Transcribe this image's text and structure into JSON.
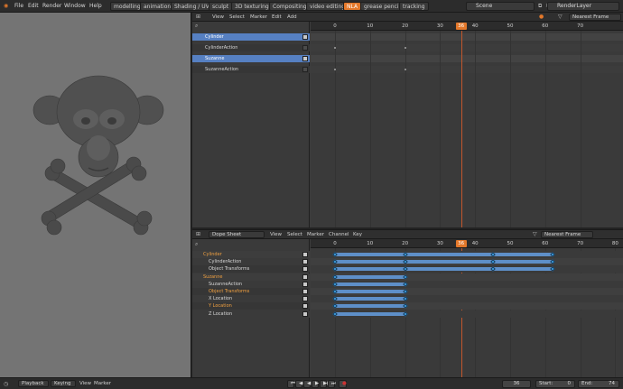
{
  "topbar": {
    "menus": [
      "File",
      "Edit",
      "Render",
      "Window",
      "Help"
    ],
    "workspaces": [
      "modelling",
      "animation",
      "Shading / UV",
      "sculpt",
      "3D texturing",
      "Compositing",
      "video editing",
      "NLA",
      "grease pencil",
      "tracking"
    ],
    "active_workspace": "NLA",
    "scene": "Scene",
    "render_layer": "RenderLayer"
  },
  "nla": {
    "header": {
      "menus": [
        "View",
        "Select",
        "Marker",
        "Edit",
        "Add"
      ],
      "snap": "Nearest Frame"
    },
    "channels": [
      "Cylinder",
      "CylinderAction",
      "Suzanne",
      "SuzanneAction"
    ],
    "ruler": [
      "0",
      "10",
      "20",
      "30",
      "36",
      "40",
      "50",
      "60",
      "70"
    ]
  },
  "dopesheet": {
    "header": {
      "mode": "Dope Sheet",
      "menus": [
        "View",
        "Select",
        "Marker",
        "Channel",
        "Key"
      ],
      "snap": "Nearest Frame"
    },
    "channels": [
      "Cylinder",
      "CylinderAction",
      "Object Transforms",
      "Suzanne",
      "SuzanneAction",
      "Object Transforms",
      "X Location",
      "Y Location",
      "Z Location"
    ],
    "ruler": [
      "0",
      "10",
      "20",
      "30",
      "36",
      "40",
      "50",
      "60",
      "70",
      "80"
    ]
  },
  "bottombar": {
    "menus": [
      "Playback",
      "Keying",
      "View",
      "Marker"
    ],
    "current_frame": "36",
    "start_label": "Start:",
    "start_value": "0",
    "end_label": "End:",
    "end_value": "74"
  },
  "colors": {
    "accent": "#e4782a",
    "selection": "#5680c2",
    "keyframe": "#3da2e6"
  }
}
